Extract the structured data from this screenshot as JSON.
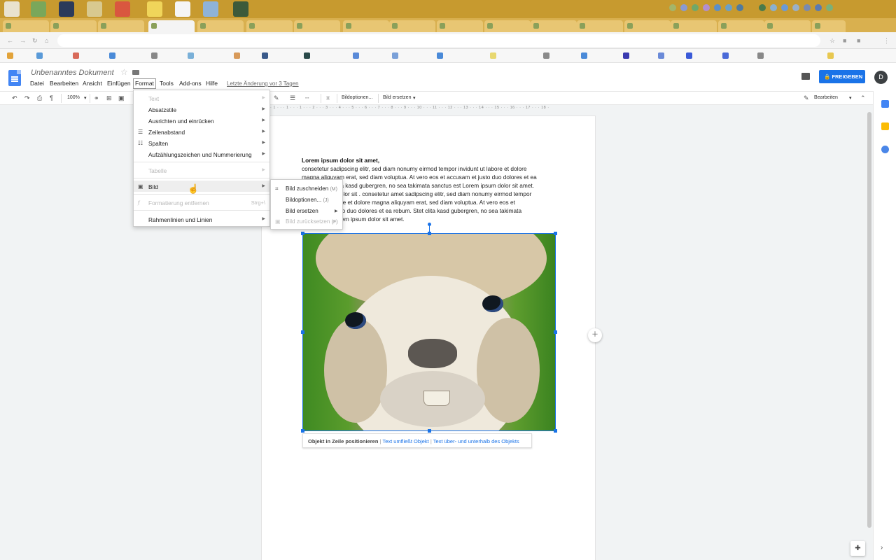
{
  "document": {
    "title": "Unbenanntes Dokument",
    "last_edit": "Letzte Änderung vor 3 Tagen",
    "share_label": "FREIGEBEN",
    "avatar_letter": "D",
    "heading": "Lorem ipsum dolor sit amet,",
    "body_lines": [
      "consetetur sadipscing elitr, sed diam nonumy eirmod tempor invidunt ut labore et dolore",
      "magna aliquyam erat, sed diam voluptua. At vero eos et accusam et justo duo dolores et ea",
      "rebum. Stet clita kasd gubergren, no sea takimata sanctus est Lorem ipsum dolor sit amet.",
      "Lorem ipsum dolor sit . consetetur amet sadipscing elitr, sed diam nonumy eirmod tempor",
      "invidunt ut labore et dolore magna aliquyam erat, sed diam voluptua. At vero eos et",
      "accusam et justo duo dolores et ea rebum. Stet clita kasd gubergren, no sea takimata",
      "sanctus est Lorem ipsum dolor sit amet."
    ]
  },
  "menubar": [
    "Datei",
    "Bearbeiten",
    "Ansicht",
    "Einfügen",
    "Format",
    "Tools",
    "Add-ons",
    "Hilfe"
  ],
  "toolbar": {
    "zoom": "100%",
    "image_options": "Bildoptionen...",
    "replace_image": "Bild ersetzen",
    "edit_mode": "Bearbeiten"
  },
  "ruler_text": "· 1 · · · 1 · · · 1 · · · 2 · · · 3 · · · 4 · · · 5 · · · 6 · · · 7 · · · 8 · · · 9 · · · 10 · · · 11 · · · 12 · · · 13 · · · 14 · · · 15 · · · 16 · · · 17 · · · 18 ·",
  "format_menu": {
    "text": "Text",
    "absatzstile": "Absatzstile",
    "ausrichten": "Ausrichten und einrücken",
    "zeilenabstand": "Zeilenabstand",
    "spalten": "Spalten",
    "aufzaehlung": "Aufzählungszeichen und Nummerierung",
    "tabelle": "Tabelle",
    "bild": "Bild",
    "formatierung": "Formatierung entfernen",
    "formatierung_shortcut": "Strg+\\",
    "rahmen": "Rahmenlinien und Linien"
  },
  "bild_submenu": {
    "zuschneiden": "Bild zuschneiden",
    "zuschneiden_key": "(M)",
    "optionen": "Bildoptionen...",
    "optionen_key": "(J)",
    "ersetzen": "Bild ersetzen",
    "zuruecksetzen": "Bild zurücksetzen",
    "zuruecksetzen_key": "(F)"
  },
  "image_layout": {
    "inline": "Objekt in Zeile positionieren",
    "wrap": "Text umfließt Objekt",
    "break": "Text über- und unterhalb des Objekts"
  },
  "colors": {
    "accent": "#1a73e8",
    "taskbar": "#c79a2f",
    "docs_blue": "#4285f4"
  }
}
